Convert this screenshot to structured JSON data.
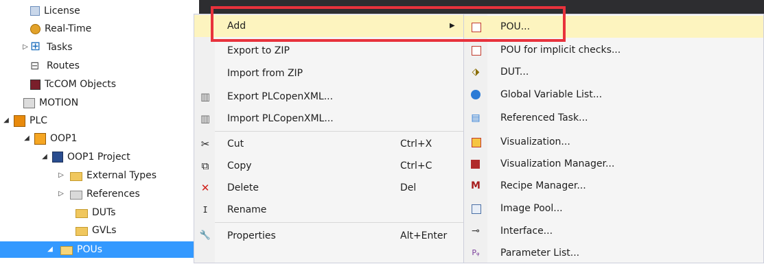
{
  "tree": {
    "items": [
      {
        "label": "License",
        "icon": "license-icon",
        "expander": ""
      },
      {
        "label": "Real-Time",
        "icon": "realtime-icon",
        "expander": ""
      },
      {
        "label": "Tasks",
        "icon": "tasks-icon",
        "expander": "▷"
      },
      {
        "label": "Routes",
        "icon": "routes-icon",
        "expander": ""
      },
      {
        "label": "TcCOM Objects",
        "icon": "tccom-icon",
        "expander": ""
      },
      {
        "label": "MOTION",
        "icon": "motion-icon",
        "expander": ""
      },
      {
        "label": "PLC",
        "icon": "plc-icon",
        "expander": "◢"
      },
      {
        "label": "OOP1",
        "icon": "plc-project-icon",
        "expander": "◢"
      },
      {
        "label": "OOP1 Project",
        "icon": "project-icon",
        "expander": "◢"
      },
      {
        "label": "External Types",
        "icon": "folder-icon",
        "expander": "▷"
      },
      {
        "label": "References",
        "icon": "references-icon",
        "expander": "▷"
      },
      {
        "label": "DUTs",
        "icon": "folder-icon",
        "expander": ""
      },
      {
        "label": "GVLs",
        "icon": "folder-icon",
        "expander": ""
      },
      {
        "label": "POUs",
        "icon": "folder-open-icon",
        "expander": "◢",
        "selected": true
      }
    ]
  },
  "context_menu": {
    "items": [
      {
        "label": "Add",
        "icon": "",
        "shortcut": "",
        "submenu_arrow": "▶"
      },
      {
        "label": "Export to ZIP",
        "icon": "",
        "shortcut": ""
      },
      {
        "label": "Import from ZIP",
        "icon": "",
        "shortcut": ""
      },
      {
        "label": "Export PLCopenXML...",
        "icon": "export-xml-icon",
        "shortcut": ""
      },
      {
        "label": "Import PLCopenXML...",
        "icon": "import-xml-icon",
        "shortcut": ""
      },
      {
        "label": "Cut",
        "icon": "cut-icon",
        "shortcut": "Ctrl+X"
      },
      {
        "label": "Copy",
        "icon": "copy-icon",
        "shortcut": "Ctrl+C"
      },
      {
        "label": "Delete",
        "icon": "delete-icon",
        "shortcut": "Del"
      },
      {
        "label": "Rename",
        "icon": "rename-icon",
        "shortcut": ""
      },
      {
        "label": "Properties",
        "icon": "properties-icon",
        "shortcut": "Alt+Enter"
      }
    ],
    "glyphs": {
      "cut": "✂",
      "copy": "⧉",
      "delete": "✕",
      "rename": "ⵊ",
      "properties": "🔧",
      "export_xml": "▥",
      "import_xml": "▥"
    }
  },
  "submenu": {
    "items": [
      {
        "label": "POU...",
        "icon": "pou-icon"
      },
      {
        "label": "POU for implicit checks...",
        "icon": "pou-checks-icon"
      },
      {
        "label": "DUT...",
        "icon": "dut-icon"
      },
      {
        "label": "Global Variable List...",
        "icon": "gvl-icon"
      },
      {
        "label": "Referenced Task...",
        "icon": "referenced-task-icon"
      },
      {
        "label": "Visualization...",
        "icon": "visualization-icon"
      },
      {
        "label": "Visualization Manager...",
        "icon": "visualization-manager-icon"
      },
      {
        "label": "Recipe Manager...",
        "icon": "recipe-manager-icon"
      },
      {
        "label": "Image Pool...",
        "icon": "image-pool-icon"
      },
      {
        "label": "Interface...",
        "icon": "interface-icon"
      },
      {
        "label": "Parameter List...",
        "icon": "parameter-list-icon"
      }
    ],
    "glyphs": {
      "dut": "⬗",
      "task": "▤",
      "recipe": "M",
      "interface": "⊸",
      "param": "Pᵩ"
    }
  },
  "colors": {
    "highlight_box": "#e8323c",
    "menu_hover": "#fdf4bf",
    "tree_selected": "#3399ff"
  }
}
